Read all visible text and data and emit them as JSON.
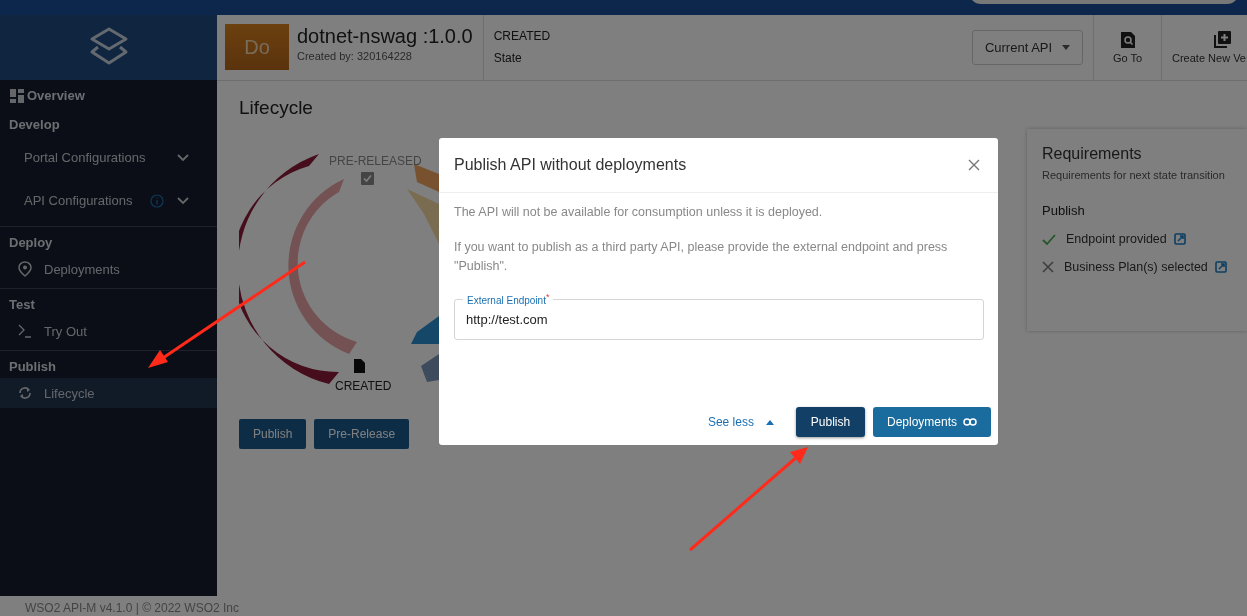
{
  "sidebar": {
    "overview": "Overview",
    "sections": [
      {
        "title": "Develop",
        "items": [
          {
            "label": "Portal Configurations",
            "kind": "expand",
            "info": false,
            "selected": false
          },
          {
            "label": "API Configurations",
            "kind": "expand",
            "info": true,
            "selected": false
          }
        ]
      },
      {
        "title": "Deploy",
        "items": [
          {
            "label": "Deployments",
            "kind": "pin",
            "info": false,
            "selected": false
          }
        ]
      },
      {
        "title": "Test",
        "items": [
          {
            "label": "Try Out",
            "kind": "terminal",
            "info": false,
            "selected": false
          }
        ]
      },
      {
        "title": "Publish",
        "items": [
          {
            "label": "Lifecycle",
            "kind": "cycle",
            "info": false,
            "selected": true
          }
        ]
      }
    ]
  },
  "header": {
    "avatar": "Do",
    "api_name": "dotnet-nswag :1.0.0",
    "created_by": "Created by: 320164228",
    "state_value": "CREATED",
    "state_label": "State",
    "version_select": "Current API",
    "go_to": "Go To",
    "create_new": "Create New Ve"
  },
  "lifecycle": {
    "title": "Lifecycle",
    "states": [
      "PRE-RELEASED",
      "CREATED"
    ],
    "buttons": [
      "Publish",
      "Pre-Release"
    ]
  },
  "requirements": {
    "title": "Requirements",
    "subtitle": "Requirements for next state transition",
    "group": "Publish",
    "items": [
      {
        "label": "Endpoint provided",
        "met": true
      },
      {
        "label": "Business Plan(s) selected",
        "met": false
      }
    ]
  },
  "dialog": {
    "title": "Publish API without deployments",
    "message": "The API will not be available for consumption unless it is deployed.",
    "hint": "If you want to publish as a third party API, please provide the external endpoint and press \"Publish\".",
    "field": {
      "label": "External Endpoint",
      "required_mark": "*",
      "value": "http://test.com"
    },
    "toggle": "See less",
    "buttons": [
      {
        "label": "Publish",
        "kind": "primary"
      },
      {
        "label": "Deployments",
        "kind": "link"
      }
    ]
  },
  "footer": "WSO2 API-M v4.1.0 | © 2022 WSO2 Inc"
}
